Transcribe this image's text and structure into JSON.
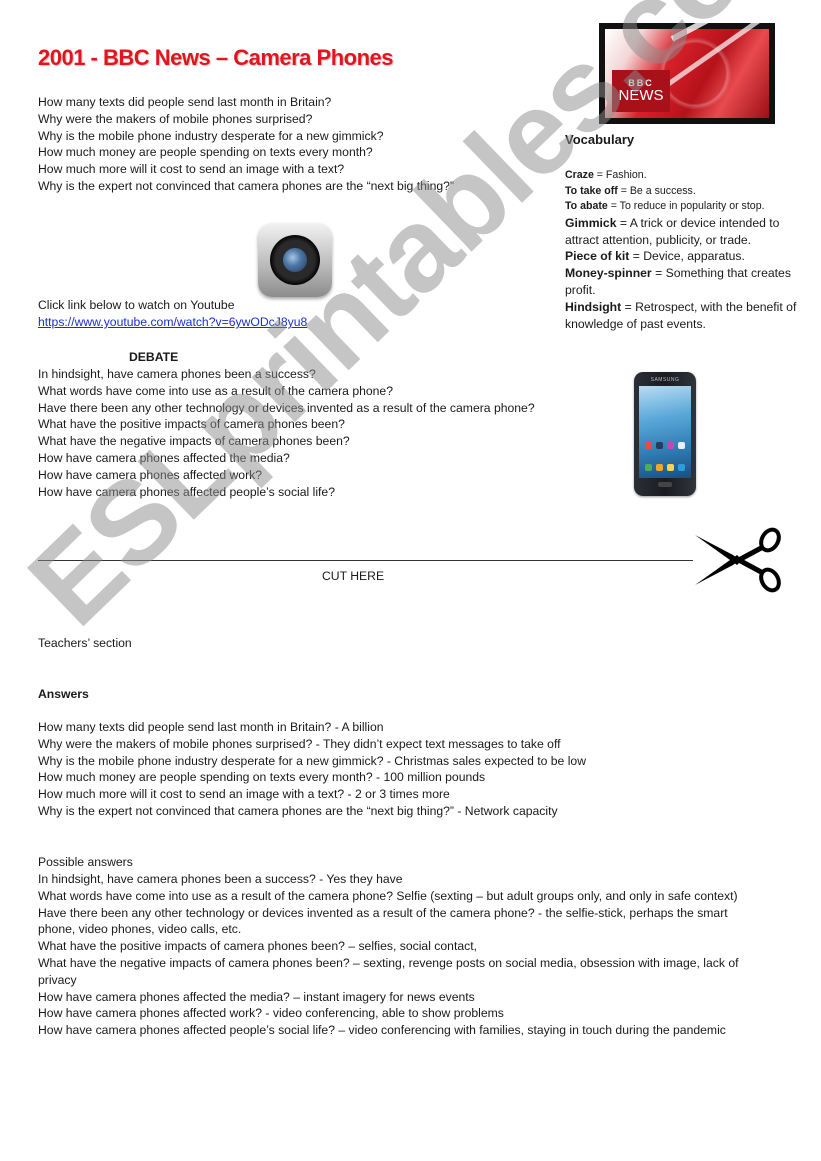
{
  "title": "2001 - BBC News – Camera Phones",
  "questions": [
    "How many texts did people send last month in Britain?",
    "Why were the makers of mobile phones surprised?",
    "Why is the mobile phone industry desperate for a new gimmick?",
    "How much money are people spending on texts every month?",
    "How much more will it cost to send an image with a text?",
    "Why is the expert not convinced that camera phones are the “next big thing?”"
  ],
  "video": {
    "prompt": "Click link below to watch on Youtube",
    "url": "https://www.youtube.com/watch?v=6ywODcJ8yu8"
  },
  "bbc_logo": {
    "line1": "BBC",
    "line2": "NEWS"
  },
  "vocabulary": {
    "heading": "Vocabulary",
    "items": [
      {
        "term": "Craze",
        "definition": " = Fashion."
      },
      {
        "term": "To take off",
        "definition": " = Be a success."
      },
      {
        "term": "To abate",
        "definition": " = To reduce in popularity or stop."
      },
      {
        "term": "Gimmick",
        "definition": " = A trick or device intended to attract attention, publicity, or trade."
      },
      {
        "term": "Piece of kit",
        "definition": " = Device, apparatus."
      },
      {
        "term": "Money-spinner",
        "definition": " = Something that creates profit."
      },
      {
        "term": "Hindsight",
        "definition": " = Retrospect, with the benefit of knowledge of past events."
      }
    ]
  },
  "debate": {
    "heading": "DEBATE",
    "questions": [
      "In hindsight, have camera phones been a success?",
      "What words have come into use as a result of the camera phone?",
      "Have there been any other technology or devices invented as a result of the camera phone?",
      "What have the positive impacts of camera phones been?",
      "What have the negative impacts of camera phones been?",
      "How have camera phones affected the media?",
      "How have camera phones affected work?",
      "How have camera phones affected people’s social life?"
    ]
  },
  "phone": {
    "brand": "SAMSUNG"
  },
  "cut_here": "CUT HERE",
  "teachers_section": "Teachers’ section",
  "answers": {
    "heading": "Answers",
    "items": [
      "How many texts did people send last month in Britain?  -  A billion",
      "Why were the makers of mobile phones surprised?    - They didn’t expect text messages to take off",
      "Why is the mobile phone industry desperate for a new gimmick?  -  Christmas sales expected to be low",
      "How much money are people spending on texts every month?  - 100 million pounds",
      "How much more will it cost to send an image with a text?  -  2 or 3 times more",
      "Why is the expert not convinced that camera phones are the “next big thing?”  - Network capacity"
    ]
  },
  "possible_answers": {
    "heading": "Possible answers",
    "items": [
      "In hindsight, have camera phones been a success?  - Yes they have",
      "What words have come into use as a result of the camera phone?  Selfie (sexting – but adult groups only, and only in safe context)",
      "Have there been any other technology or devices invented as a result of the camera phone?  - the selfie-stick, perhaps the smart",
      "phone, video phones, video calls, etc.",
      "What have the positive impacts of camera phones been? – selfies, social contact,",
      "What have the negative impacts of camera phones been? – sexting, revenge posts on social media, obsession with image, lack of",
      "privacy",
      "How have camera phones affected the media? – instant imagery for news events",
      "How have camera phones affected work?  - video conferencing, able to show problems",
      "How have camera phones affected people’s social life? – video conferencing with families, staying in touch during the pandemic"
    ]
  },
  "watermark": "ESLprintables.com",
  "colors": {
    "title": "#e0161e",
    "link": "#1a2fc9",
    "bbc_red": "#a8101a"
  }
}
